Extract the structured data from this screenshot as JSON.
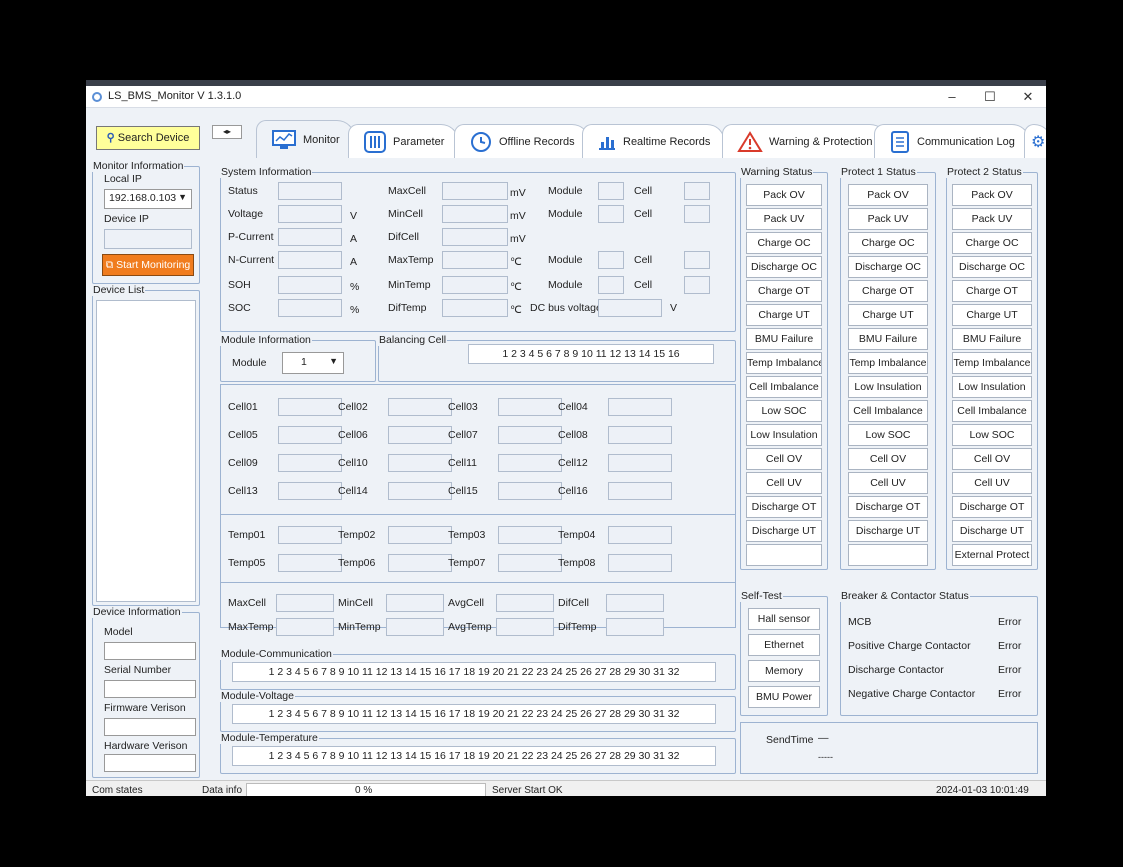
{
  "window": {
    "title": "LS_BMS_Monitor V 1.3.1.0",
    "controls": {
      "minimize": "–",
      "maximize": "☐",
      "close": "✕"
    }
  },
  "toolbar": {
    "search_label": "Search Device",
    "nav_arrows": "◂▸"
  },
  "tabs": [
    "Monitor",
    "Parameter",
    "Offline Records",
    "Realtime Records",
    "Warning & Protection",
    "Communication Log"
  ],
  "monitor_info": {
    "legend": "Monitor Information",
    "local_ip_label": "Local IP",
    "local_ip": "192.168.0.103",
    "device_ip_label": "Device IP",
    "start_label": "Start Monitoring"
  },
  "device_list": {
    "legend": "Device List"
  },
  "device_info": {
    "legend": "Device Information",
    "fields": [
      "Model",
      "Serial Number",
      "Firmware Verison",
      "Hardware Verison"
    ]
  },
  "system_info": {
    "legend": "System Information",
    "left": [
      "Status",
      "Voltage",
      "P-Current",
      "N-Current",
      "SOH",
      "SOC"
    ],
    "left_units": [
      "",
      "V",
      "A",
      "A",
      "%",
      "%"
    ],
    "mid": [
      "MaxCell",
      "MinCell",
      "DifCell",
      "MaxTemp",
      "MinTemp",
      "DifTemp"
    ],
    "mid_units": [
      "mV",
      "mV",
      "mV",
      "℃",
      "℃",
      "℃"
    ],
    "module_label": "Module",
    "cell_label": "Cell",
    "dc_bus_label": "DC bus voltage",
    "dc_bus_unit": "V"
  },
  "module_info": {
    "legend": "Module Information",
    "module_label": "Module",
    "module_value": "1"
  },
  "balancing": {
    "legend": "Balancing Cell",
    "numbers": "1 2 3 4 5 6 7 8 9 10 11 12 13 14 15 16"
  },
  "cells": [
    "Cell01",
    "Cell02",
    "Cell03",
    "Cell04",
    "Cell05",
    "Cell06",
    "Cell07",
    "Cell08",
    "Cell09",
    "Cell10",
    "Cell11",
    "Cell12",
    "Cell13",
    "Cell14",
    "Cell15",
    "Cell16"
  ],
  "temps": [
    "Temp01",
    "Temp02",
    "Temp03",
    "Temp04",
    "Temp05",
    "Temp06",
    "Temp07",
    "Temp08"
  ],
  "summary": [
    "MaxCell",
    "MinCell",
    "AvgCell",
    "DifCell",
    "MaxTemp",
    "MinTemp",
    "AvgTemp",
    "DifTemp"
  ],
  "module_comm": {
    "legend": "Module-Communication",
    "numbers": "1 2 3 4 5 6 7 8 9 10 11 12 13 14 15 16 17 18 19 20 21 22 23 24 25 26 27 28 29 30 31 32"
  },
  "module_voltage": {
    "legend": "Module-Voltage",
    "numbers": "1 2 3 4 5 6 7 8 9 10 11 12 13 14 15 16 17 18 19 20 21 22 23 24 25 26 27 28 29 30 31 32"
  },
  "module_temp": {
    "legend": "Module-Temperature",
    "numbers": "1 2 3 4 5 6 7 8 9 10 11 12 13 14 15 16 17 18 19 20 21 22 23 24 25 26 27 28 29 30 31 32"
  },
  "warning_status": {
    "legend": "Warning Status",
    "items": [
      "Pack OV",
      "Pack UV",
      "Charge OC",
      "Discharge OC",
      "Charge OT",
      "Charge UT",
      "BMU Failure",
      "Temp Imbalance",
      "Cell Imbalance",
      "Low SOC",
      "Low Insulation",
      "Cell OV",
      "Cell UV",
      "Discharge OT",
      "Discharge UT",
      ""
    ]
  },
  "protect1_status": {
    "legend": "Protect 1 Status",
    "items": [
      "Pack OV",
      "Pack UV",
      "Charge OC",
      "Discharge OC",
      "Charge OT",
      "Charge UT",
      "BMU Failure",
      "Temp Imbalance",
      "Low Insulation",
      "Cell Imbalance",
      "Low SOC",
      "Cell OV",
      "Cell UV",
      "Discharge OT",
      "Discharge UT",
      ""
    ]
  },
  "protect2_status": {
    "legend": "Protect 2 Status",
    "items": [
      "Pack OV",
      "Pack UV",
      "Charge OC",
      "Discharge OC",
      "Charge OT",
      "Charge UT",
      "BMU Failure",
      "Temp Imbalance",
      "Low Insulation",
      "Cell Imbalance",
      "Low SOC",
      "Cell OV",
      "Cell UV",
      "Discharge OT",
      "Discharge UT",
      "External Protect"
    ]
  },
  "self_test": {
    "legend": "Self-Test",
    "items": [
      "Hall sensor",
      "Ethernet",
      "Memory",
      "BMU Power"
    ]
  },
  "breaker": {
    "legend": "Breaker & Contactor Status",
    "rows": [
      {
        "name": "MCB",
        "status": "Error"
      },
      {
        "name": "Positive Charge Contactor",
        "status": "Error"
      },
      {
        "name": "Discharge Contactor",
        "status": "Error"
      },
      {
        "name": "Negative Charge Contactor",
        "status": "Error"
      }
    ]
  },
  "send_time": {
    "label": "SendTime",
    "value": "—",
    "value2": "-----"
  },
  "statusbar": {
    "com_states": "Com states",
    "data_info": "Data info",
    "progress": "0 %",
    "server": "Server Start OK",
    "datetime": "2024-01-03 10:01:49"
  },
  "colors": {
    "search_bg": "#ffff9a",
    "start_bg": "#f07c1e",
    "window_bg": "#eef2f7",
    "border_blue": "#9db3d1",
    "warning_red": "#d93a2b"
  }
}
